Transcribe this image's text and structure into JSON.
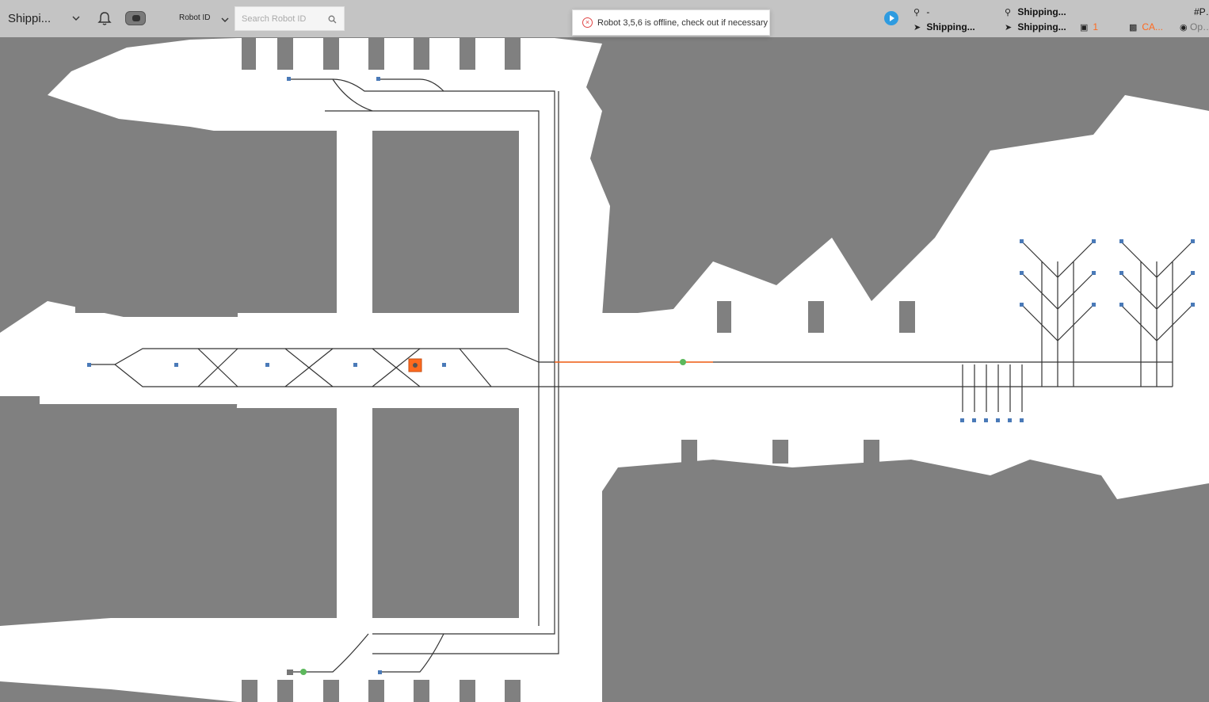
{
  "header": {
    "site_name": "Shippi...",
    "robot_id_label": "Robot ID",
    "search_placeholder": "Search Robot ID"
  },
  "notification": {
    "message": "Robot 3,5,6 is offline, check out if necessary"
  },
  "status": {
    "current_location": "-",
    "current_target": "Shipping...",
    "next_location": "Shipping...",
    "next_target": "Shipping...",
    "task_count": "1",
    "status_code": "CA...",
    "tag_label": "#P…",
    "option_label": "Op…"
  },
  "colors": {
    "accent": "#2e9be0",
    "alert": "#ff6a1f",
    "error": "#e04545",
    "map_unknown": "#808080",
    "map_free": "#ffffff"
  }
}
